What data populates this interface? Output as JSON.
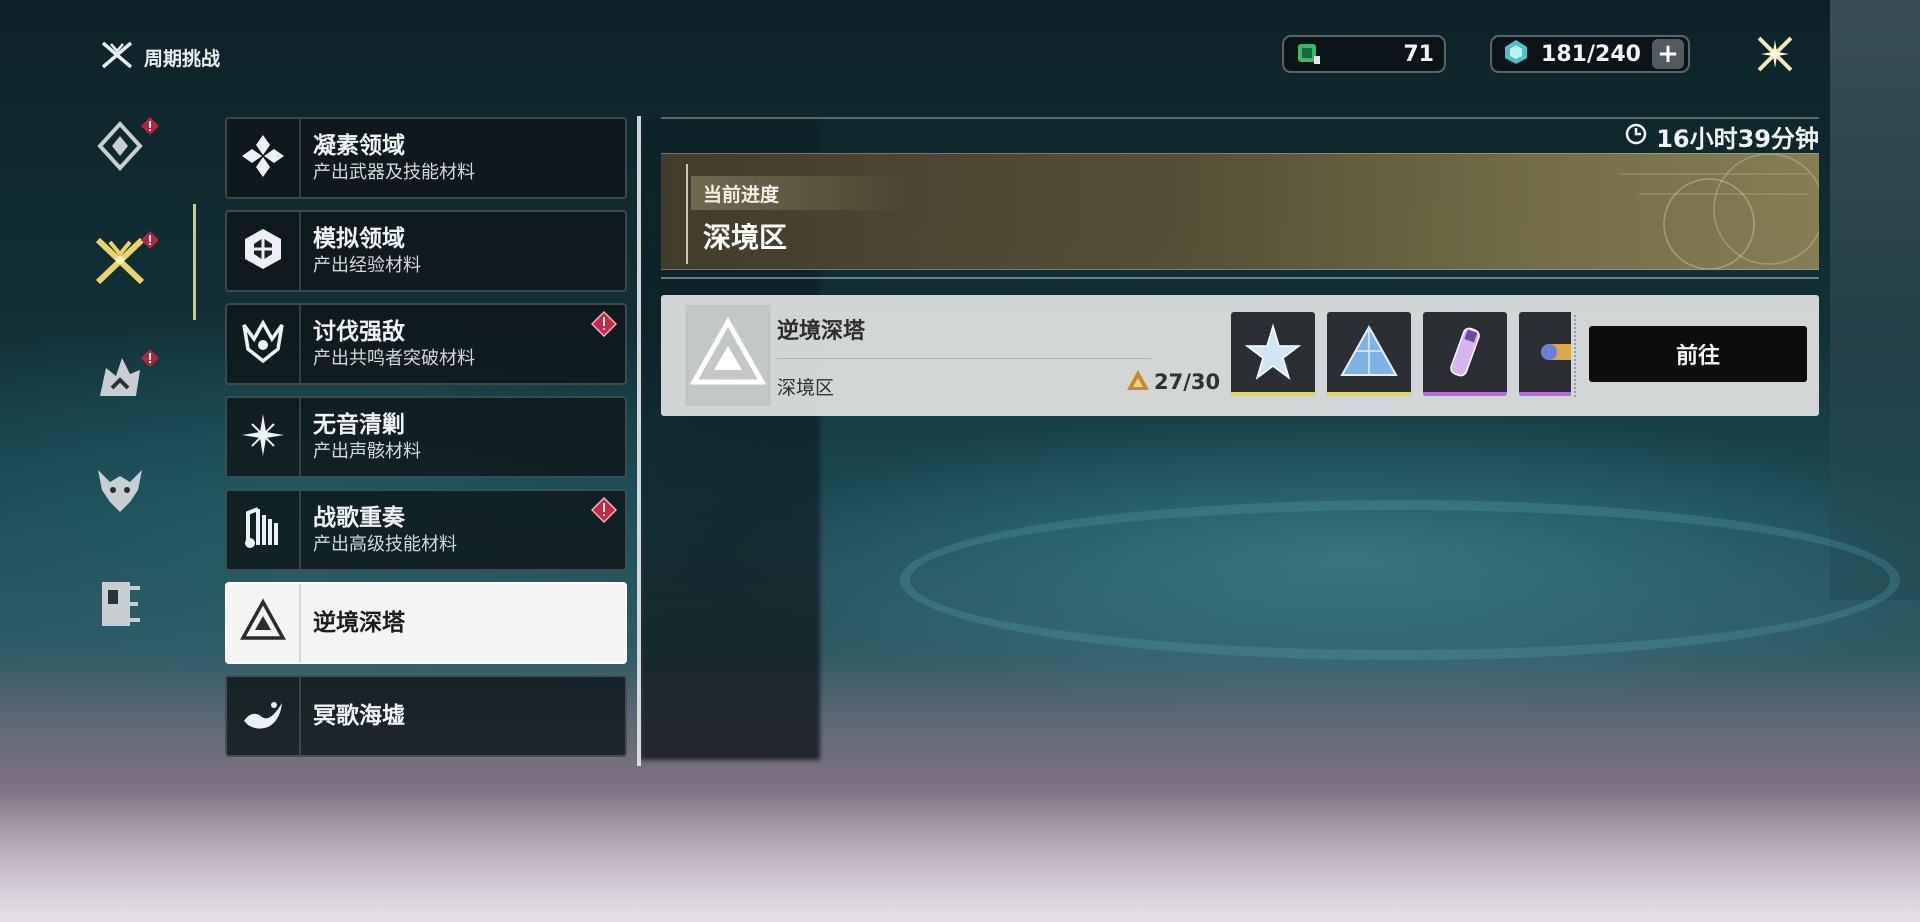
{
  "header": {
    "title": "周期挑战",
    "icon": "crossed-swords-icon"
  },
  "currencies": [
    {
      "icon": "green-battery-icon",
      "value": "71"
    },
    {
      "icon": "cyan-crystal-icon",
      "value": "181/240",
      "has_plus": true
    }
  ],
  "close_icon": "close-sparkle-icon",
  "rail": {
    "active_index": 1,
    "items": [
      {
        "icon": "diamond-emblem-icon",
        "badge": true
      },
      {
        "icon": "crossed-swords-icon",
        "badge": true,
        "active": true
      },
      {
        "icon": "flame-mask-icon",
        "badge": true
      },
      {
        "icon": "dragon-head-icon",
        "badge": false
      },
      {
        "icon": "gate-icon",
        "badge": false
      }
    ]
  },
  "categories": [
    {
      "name": "凝素领域",
      "desc": "产出武器及技能材料",
      "icon": "crystal-cluster-icon",
      "badge": false
    },
    {
      "name": "模拟领域",
      "desc": "产出经验材料",
      "icon": "hex-core-icon",
      "badge": false
    },
    {
      "name": "讨伐强敌",
      "desc": "产出共鸣者突破材料",
      "icon": "horned-crest-icon",
      "badge": true
    },
    {
      "name": "无音清剿",
      "desc": "产出声骸材料",
      "icon": "star-burst-icon",
      "badge": false
    },
    {
      "name": "战歌重奏",
      "desc": "产出高级技能材料",
      "icon": "music-bars-icon",
      "badge": true
    },
    {
      "name": "逆境深塔",
      "desc": "",
      "icon": "triangle-tower-icon",
      "badge": false,
      "active": true
    },
    {
      "name": "冥歌海墟",
      "desc": "",
      "icon": "wave-bird-icon",
      "badge": false
    }
  ],
  "timer": {
    "icon": "clock-icon",
    "text": "16小时39分钟"
  },
  "progress": {
    "label": "当前进度",
    "zone": "深境区"
  },
  "tower_card": {
    "title": "逆境深塔",
    "zone": "深境区",
    "stars_icon": "triangle-star-icon",
    "stars": "27/30",
    "rewards": [
      {
        "name": "star-crystal",
        "rarity_color": "#e6d36a"
      },
      {
        "name": "blue-prism",
        "rarity_color": "#e6d36a"
      },
      {
        "name": "purple-tube",
        "rarity_color": "#b56be0"
      },
      {
        "name": "gold-capsule",
        "rarity_color": "#b56be0"
      }
    ],
    "go_label": "前往"
  }
}
